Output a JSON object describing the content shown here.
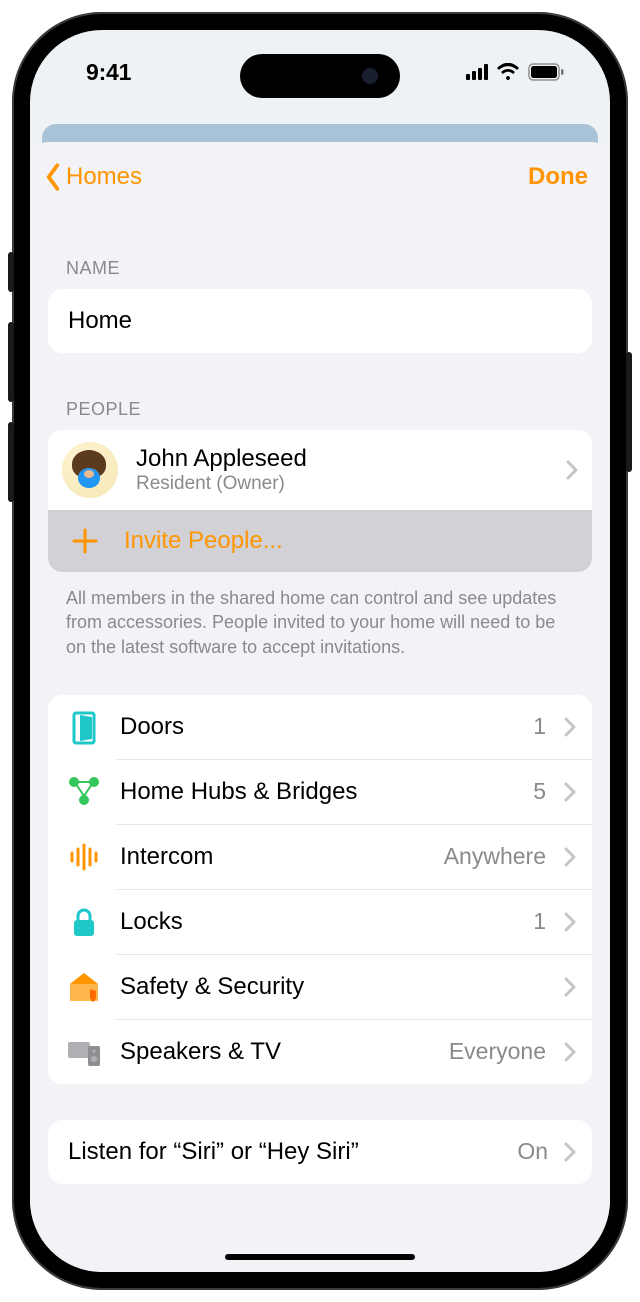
{
  "status": {
    "time": "9:41"
  },
  "nav": {
    "back": "Homes",
    "done": "Done"
  },
  "sections": {
    "name_label": "NAME",
    "name_value": "Home",
    "people_label": "PEOPLE",
    "people_footer": "All members in the shared home can control and see updates from accessories. People invited to your home will need to be on the latest software to accept invitations."
  },
  "person": {
    "name": "John Appleseed",
    "role": "Resident (Owner)"
  },
  "invite": {
    "label": "Invite People..."
  },
  "settings": [
    {
      "label": "Doors",
      "value": "1"
    },
    {
      "label": "Home Hubs & Bridges",
      "value": "5"
    },
    {
      "label": "Intercom",
      "value": "Anywhere"
    },
    {
      "label": "Locks",
      "value": "1"
    },
    {
      "label": "Safety & Security",
      "value": ""
    },
    {
      "label": "Speakers & TV",
      "value": "Everyone"
    }
  ],
  "siri": {
    "label": "Listen for “Siri” or “Hey Siri”",
    "value": "On"
  }
}
